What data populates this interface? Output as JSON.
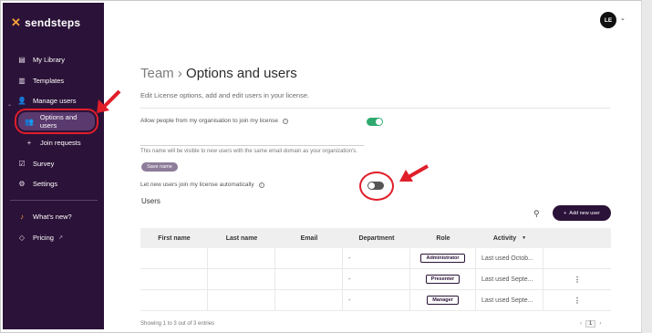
{
  "app": {
    "brand": "sendsteps",
    "accent_color": "#2b1238",
    "highlight_color": "#e01e2a",
    "toggle_on_color": "#2faa6f"
  },
  "sidebar": {
    "items": [
      {
        "label": "My Library",
        "icon": "library-icon"
      },
      {
        "label": "Templates",
        "icon": "templates-icon"
      },
      {
        "label": "Manage users",
        "icon": "users-icon"
      },
      {
        "label": "Options and users",
        "icon": "user-options-icon"
      },
      {
        "label": "Join requests",
        "icon": "join-requests-icon"
      },
      {
        "label": "Survey",
        "icon": "survey-icon"
      },
      {
        "label": "Settings",
        "icon": "gear-icon"
      },
      {
        "label": "What's new?",
        "icon": "bell-icon"
      },
      {
        "label": "Pricing",
        "icon": "tag-icon"
      }
    ]
  },
  "header": {
    "avatar_initials": "LE"
  },
  "main": {
    "breadcrumb_root": "Team",
    "breadcrumb_sep": "›",
    "title": "Options and users",
    "subtitle": "Edit License options, add and edit users in your license.",
    "setting_join": {
      "label": "Allow people from my organisation to join my license",
      "enabled": true
    },
    "name_hint": "This name will be visible to new users with the same email domain as your organization's.",
    "save_label": "Save name",
    "setting_auto": {
      "label": "Let new users join my license automatically",
      "enabled": false
    },
    "users_heading": "Users",
    "add_user_label": "Add new user",
    "columns": [
      "First name",
      "Last name",
      "Email",
      "Department",
      "Role",
      "Activity"
    ],
    "rows": [
      {
        "first": "",
        "last": "",
        "email": "",
        "department": "-",
        "role": "Administrator",
        "activity": "Last used Octob..."
      },
      {
        "first": "",
        "last": "",
        "email": "",
        "department": "-",
        "role": "Presenter",
        "activity": "Last used Septe..."
      },
      {
        "first": "",
        "last": "",
        "email": "",
        "department": "-",
        "role": "Manager",
        "activity": "Last used Septe..."
      }
    ],
    "footer_text": "Showing 1 to 3 out of 3 entries",
    "current_page": "1"
  }
}
